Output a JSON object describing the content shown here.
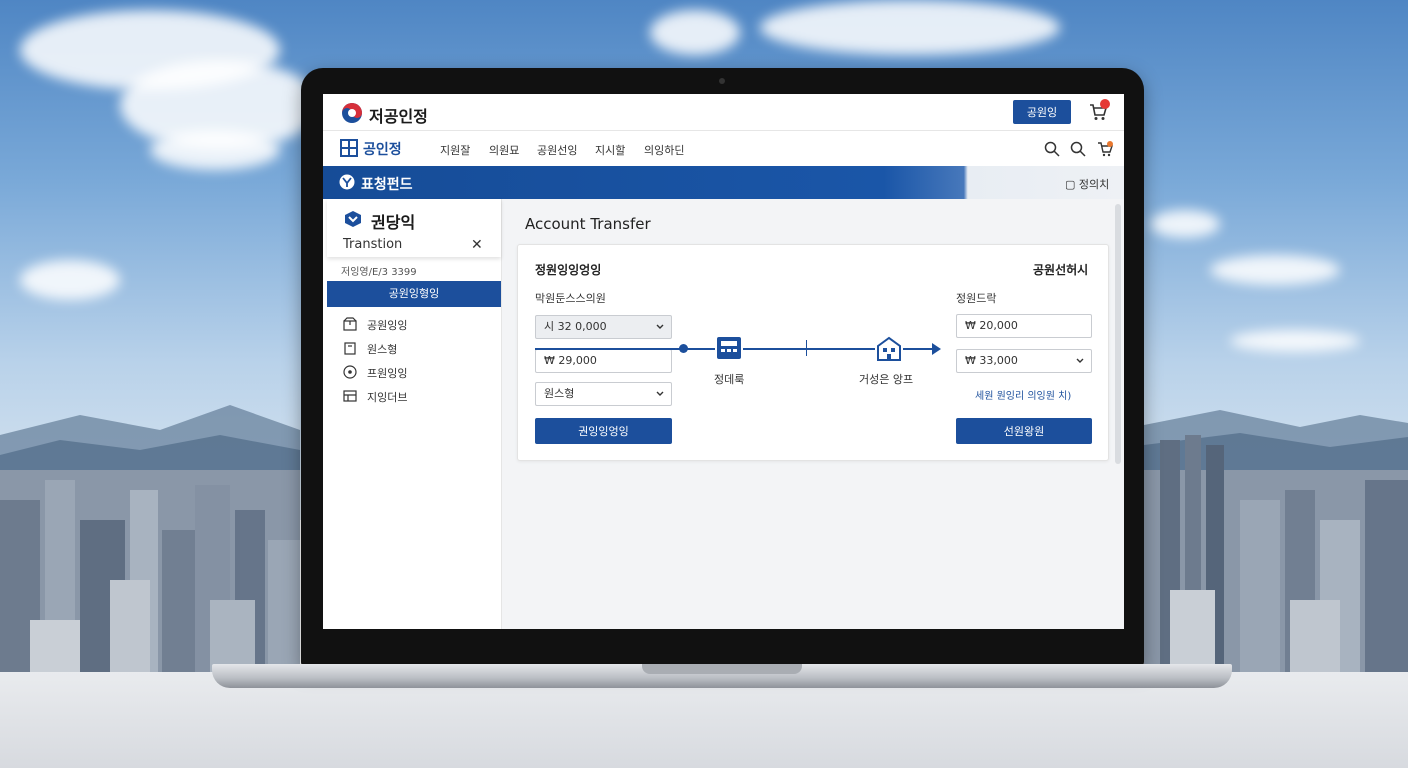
{
  "topbar": {
    "brand": "저공인정",
    "button_label": "공원잉"
  },
  "navbar": {
    "brand": "공인정",
    "items": [
      "지원잘",
      "의원묘",
      "공원선잉",
      "지시할",
      "의잉하딘"
    ]
  },
  "banner": {
    "title": "표청펀드",
    "right_label": "정의치"
  },
  "sidebar": {
    "brand": "권당익",
    "subtitle": "Transtion",
    "close_glyph": "✕",
    "meta": "저잉영/E/3 3399",
    "active_item": "공원잉형잉",
    "items": [
      "공원잉잉",
      "원스형",
      "프원잉잉",
      "지잉더브"
    ]
  },
  "main": {
    "title": "Account Transfer",
    "panel": {
      "left_heading": "정원잉잉엉잉",
      "right_heading": "공원선허시",
      "left_label": "막원둔스스의원",
      "right_label": "정원드락",
      "from_account": "시 32 0,000",
      "amount": "₩ 29,000",
      "select_option": "원스형",
      "left_button": "권잉잉엉잉",
      "to_amount": "₩ 20,000",
      "to_select": "₩ 33,000",
      "link_text": "세원 원잉리 의잉원 치)",
      "right_button": "선원왕원",
      "flow_left_caption": "정데룩",
      "flow_right_caption": "거성은 앙프"
    }
  },
  "colors": {
    "accent": "#1c4f9c",
    "badge": "#e53935"
  }
}
